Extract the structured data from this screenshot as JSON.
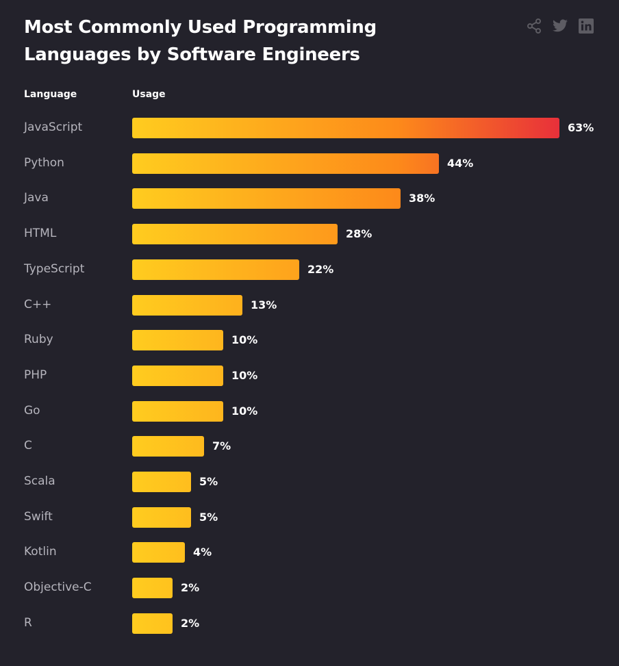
{
  "header": {
    "title": "Most Commonly Used Programming Languages by Software Engineers"
  },
  "share": {
    "icons": [
      "share-icon",
      "twitter-icon",
      "linkedin-icon"
    ]
  },
  "colors": {
    "background": "#23222b",
    "gradient_start": "#ffcc1f",
    "gradient_mid": "#fd8a1a",
    "gradient_end": "#e8303a",
    "label": "#b6b5bd",
    "icon": "#5d5c63"
  },
  "chart_data": {
    "type": "bar",
    "orientation": "horizontal",
    "title": "Most Commonly Used Programming Languages by Software Engineers",
    "column_headers": {
      "category": "Language",
      "value": "Usage"
    },
    "categories": [
      "JavaScript",
      "Python",
      "Java",
      "HTML",
      "TypeScript",
      "C++",
      "Ruby",
      "PHP",
      "Go",
      "C",
      "Scala",
      "Swift",
      "Kotlin",
      "Objective-C",
      "R"
    ],
    "values": [
      63,
      44,
      38,
      28,
      22,
      13,
      10,
      10,
      10,
      7,
      5,
      5,
      4,
      2,
      2
    ],
    "value_labels": [
      "63%",
      "44%",
      "38%",
      "28%",
      "22%",
      "13%",
      "10%",
      "10%",
      "10%",
      "7%",
      "5%",
      "5%",
      "4%",
      "2%",
      "2%"
    ],
    "unit": "%",
    "xlabel": "",
    "ylabel": "",
    "grid": false,
    "legend": "none"
  }
}
